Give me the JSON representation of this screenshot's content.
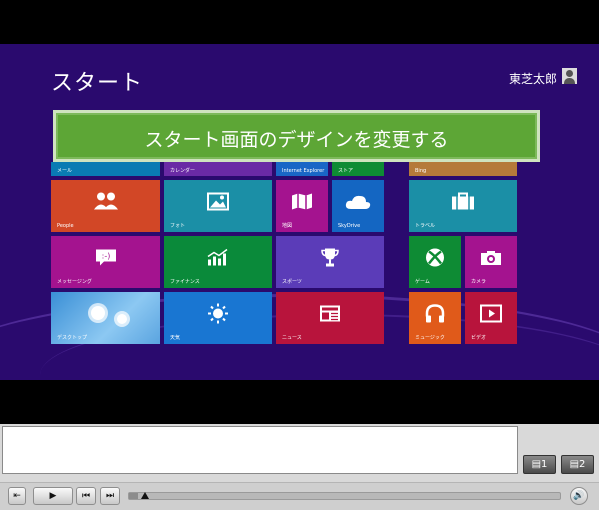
{
  "screen": {
    "title": "スタート",
    "user_name": "東芝太郎",
    "banner_text": "スタート画面のデザインを変更する",
    "colors": {
      "background": "#2a0a6e",
      "banner": "#5da636"
    }
  },
  "tiles": {
    "mail": "メール",
    "calendar": "カレンダー",
    "ie": "Internet Explorer",
    "store": "ストア",
    "bing": "Bing",
    "people": "People",
    "photos": "フォト",
    "maps": "地図",
    "skydrive": "SkyDrive",
    "travel": "トラベル",
    "messaging": "メッセージング",
    "finance": "ファイナンス",
    "sports": "スポーツ",
    "games": "ゲーム",
    "camera": "カメラ",
    "desktop": "デスクトップ",
    "weather": "天気",
    "news": "ニュース",
    "music": "ミュージック",
    "video": "ビデオ"
  },
  "player": {
    "subtitle_text": "",
    "caption_btn1": "1",
    "caption_btn2": "2",
    "progress": 0.02
  }
}
